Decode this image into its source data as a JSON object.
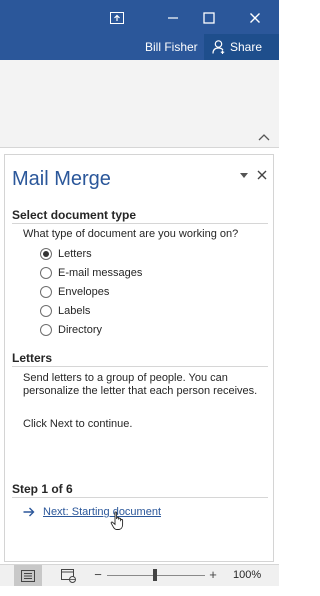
{
  "window": {
    "user_name": "Bill Fisher",
    "share_label": "Share",
    "colors": {
      "titlebar": "#2b579a",
      "accent_text": "#2b579a"
    }
  },
  "icons": {
    "restore_ribbon": "ribbon-display-options-icon",
    "minimize": "minimize-icon",
    "maximize": "maximize-icon",
    "close": "close-icon",
    "share": "person-icon"
  },
  "pane": {
    "title": "Mail Merge",
    "select_heading": "Select document type",
    "question": "What type of document are you working on?",
    "options": [
      {
        "label": "Letters",
        "checked": true
      },
      {
        "label": "E-mail messages",
        "checked": false
      },
      {
        "label": "Envelopes",
        "checked": false
      },
      {
        "label": "Labels",
        "checked": false
      },
      {
        "label": "Directory",
        "checked": false
      }
    ],
    "letters_heading": "Letters",
    "letters_desc": "Send letters to a group of people. You can personalize the letter that each person receives.",
    "continue_text": "Click Next to continue.",
    "step_text": "Step 1 of 6",
    "next_link": "Next: Starting document"
  },
  "statusbar": {
    "zoom_minus": "−",
    "zoom_plus": "+",
    "zoom_level": "100%"
  }
}
